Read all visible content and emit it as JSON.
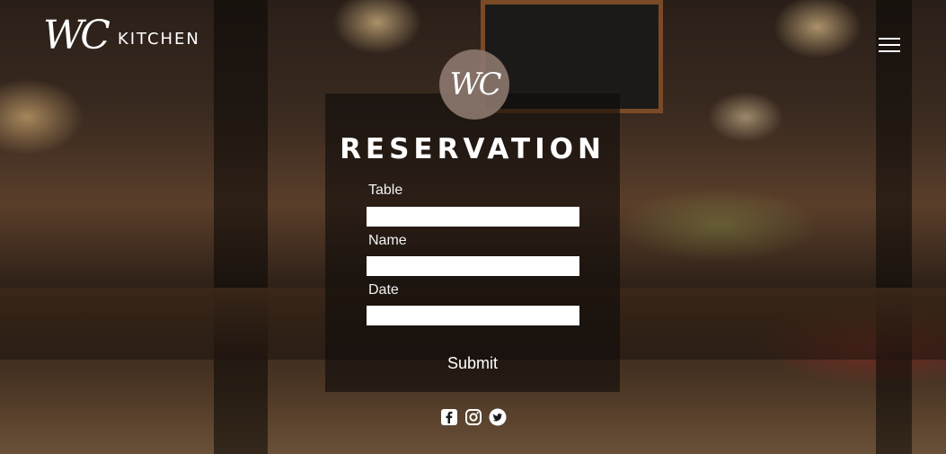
{
  "header": {
    "logo_mark": "WC",
    "logo_text": "KITCHEN",
    "menu_icon": "hamburger-menu-icon"
  },
  "badge": {
    "mark": "WC"
  },
  "form": {
    "title": "RESERVATION",
    "fields": [
      {
        "label": "Table",
        "value": "",
        "placeholder": ""
      },
      {
        "label": "Name",
        "value": "",
        "placeholder": ""
      },
      {
        "label": "Date",
        "value": "",
        "placeholder": ""
      }
    ],
    "submit_label": "Submit"
  },
  "social": [
    {
      "icon": "facebook-icon"
    },
    {
      "icon": "instagram-icon"
    },
    {
      "icon": "twitter-icon"
    }
  ],
  "colors": {
    "text": "#ffffff",
    "input_bg": "#ffffff",
    "panel_bg": "rgba(15,12,10,0.62)",
    "board_frame": "#7a4a26"
  }
}
